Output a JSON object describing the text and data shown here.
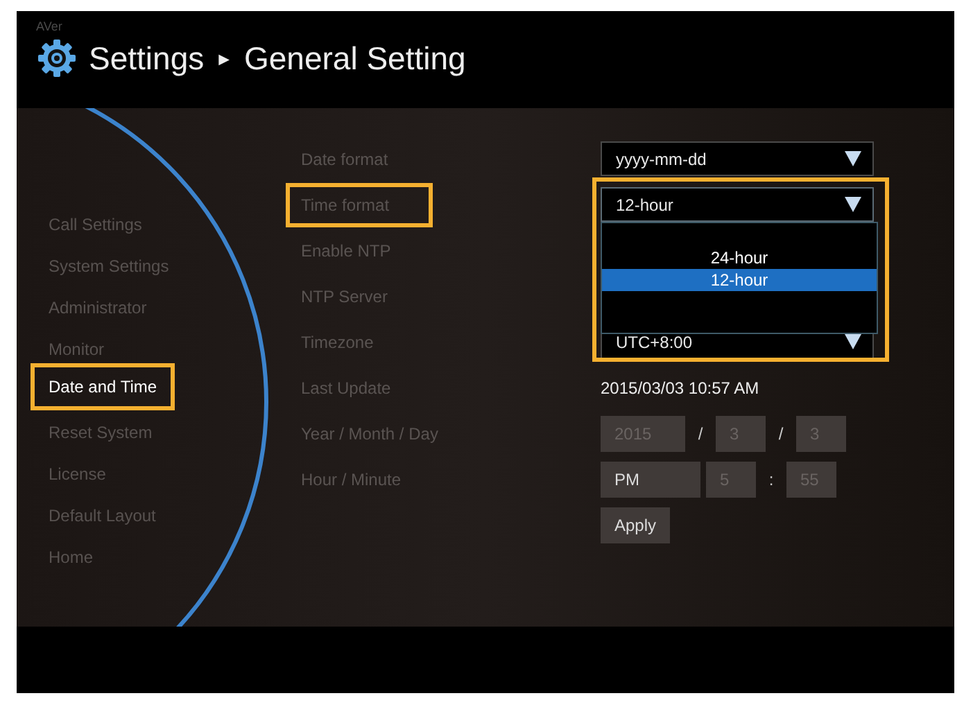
{
  "logo": {
    "text": "AVer"
  },
  "header": {
    "title": "Settings",
    "separator": "►",
    "subtitle": "General Setting"
  },
  "sidebar": {
    "items": [
      {
        "label": "Call Settings",
        "selected": false,
        "highlighted": false
      },
      {
        "label": "System Settings",
        "selected": false,
        "highlighted": false
      },
      {
        "label": "Administrator",
        "selected": false,
        "highlighted": false
      },
      {
        "label": "Monitor",
        "selected": false,
        "highlighted": false
      },
      {
        "label": "Date and Time",
        "selected": true,
        "highlighted": true
      },
      {
        "label": "Reset System",
        "selected": false,
        "highlighted": false
      },
      {
        "label": "License",
        "selected": false,
        "highlighted": false
      },
      {
        "label": "Default Layout",
        "selected": false,
        "highlighted": false
      },
      {
        "label": "Home",
        "selected": false,
        "highlighted": false
      }
    ]
  },
  "form": {
    "rows": [
      {
        "kind": "select",
        "label": "Date format",
        "label_highlighted": false,
        "value": "yyyy-mm-dd"
      },
      {
        "kind": "select",
        "label": "Time format",
        "label_highlighted": true,
        "value": "12-hour",
        "expanded": true,
        "control_highlighted": true,
        "options": [
          {
            "label": "24-hour",
            "selected": false
          },
          {
            "label": "12-hour",
            "selected": true
          }
        ]
      },
      {
        "kind": "covered",
        "label": "Enable NTP",
        "label_highlighted": false
      },
      {
        "kind": "covered",
        "label": "NTP Server",
        "label_highlighted": false
      },
      {
        "kind": "select",
        "label": "Timezone",
        "label_highlighted": false,
        "value": "UTC+8:00"
      },
      {
        "kind": "text",
        "label": "Last Update",
        "label_highlighted": false,
        "value": "2015/03/03 10:57 AM"
      },
      {
        "kind": "fields",
        "label": "Year / Month / Day",
        "label_highlighted": false,
        "parts": [
          {
            "kind": "field",
            "value": "2015",
            "disabled": true
          },
          {
            "kind": "sep",
            "text": "/"
          },
          {
            "kind": "field",
            "value": "3",
            "disabled": true
          },
          {
            "kind": "sep",
            "text": "/"
          },
          {
            "kind": "field",
            "value": "3",
            "disabled": true
          }
        ]
      },
      {
        "kind": "fields",
        "label": "Hour / Minute",
        "label_highlighted": false,
        "parts": [
          {
            "kind": "field",
            "value": "PM",
            "disabled": false
          },
          {
            "kind": "field",
            "value": "5",
            "disabled": true
          },
          {
            "kind": "sep",
            "text": ":"
          },
          {
            "kind": "field",
            "value": "55",
            "disabled": true
          }
        ]
      },
      {
        "kind": "button",
        "label": "Apply"
      }
    ]
  }
}
